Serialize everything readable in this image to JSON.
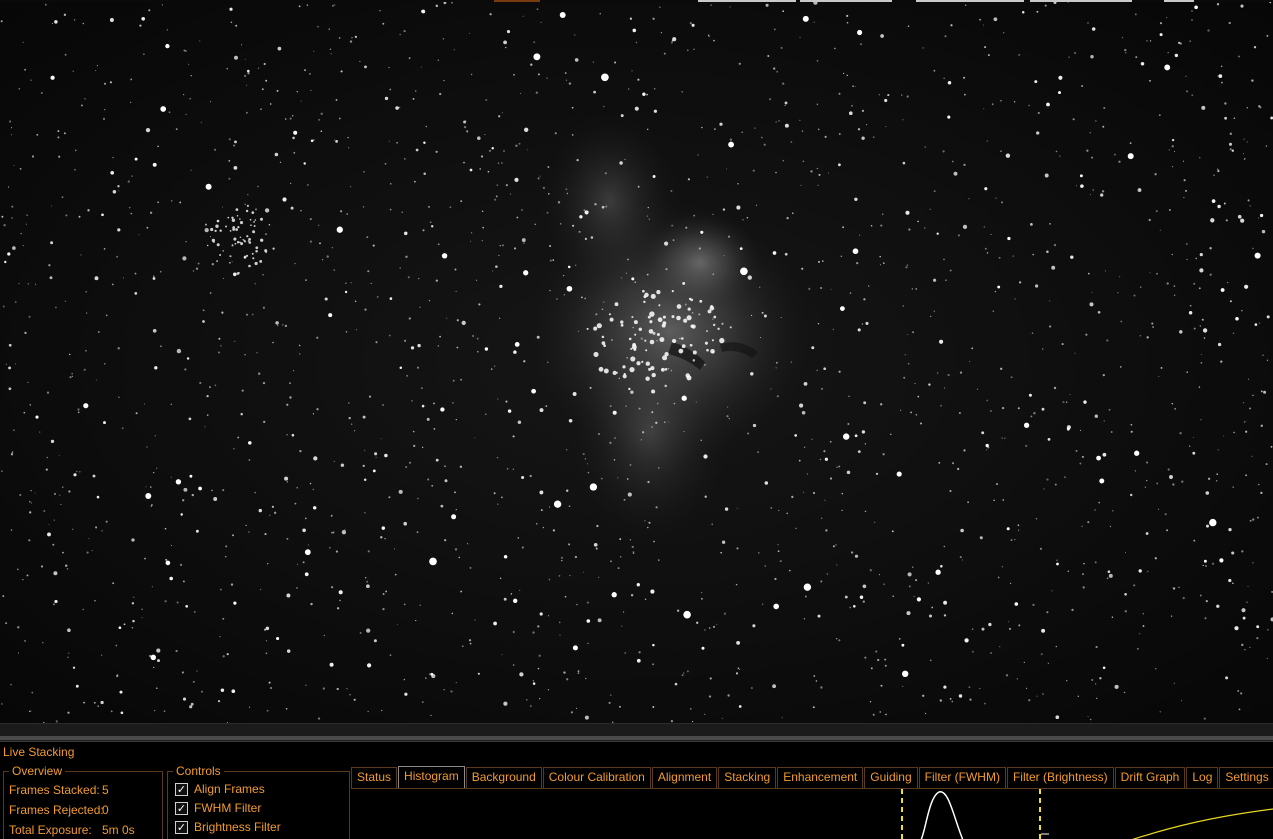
{
  "panel": {
    "title": "Live Stacking"
  },
  "overview": {
    "legend": "Overview",
    "rows": [
      {
        "label": "Frames Stacked:",
        "value": "5"
      },
      {
        "label": "Frames Rejected:",
        "value": "0"
      },
      {
        "label": "Total Exposure:",
        "value": "5m 0s"
      }
    ]
  },
  "controls": {
    "legend": "Controls",
    "items": [
      {
        "label": "Align Frames",
        "checked": true
      },
      {
        "label": "FWHM Filter",
        "checked": true
      },
      {
        "label": "Brightness Filter",
        "checked": true
      }
    ]
  },
  "tabs": [
    {
      "label": "Status",
      "active": false
    },
    {
      "label": "Histogram",
      "active": true
    },
    {
      "label": "Background",
      "active": false
    },
    {
      "label": "Colour Calibration",
      "active": false
    },
    {
      "label": "Alignment",
      "active": false
    },
    {
      "label": "Stacking",
      "active": false
    },
    {
      "label": "Enhancement",
      "active": false
    },
    {
      "label": "Guiding",
      "active": false
    },
    {
      "label": "Filter (FWHM)",
      "active": false
    },
    {
      "label": "Filter (Brightness)",
      "active": false
    },
    {
      "label": "Drift Graph",
      "active": false
    },
    {
      "label": "Log",
      "active": false
    },
    {
      "label": "Settings",
      "active": false
    }
  ],
  "colors": {
    "accent": "#f29a2e",
    "histogram_marker": "#f0e020",
    "histogram_curve": "#ffffff",
    "stretch_curve": "#e8d820"
  },
  "icons": {
    "checkbox": "check-icon"
  }
}
